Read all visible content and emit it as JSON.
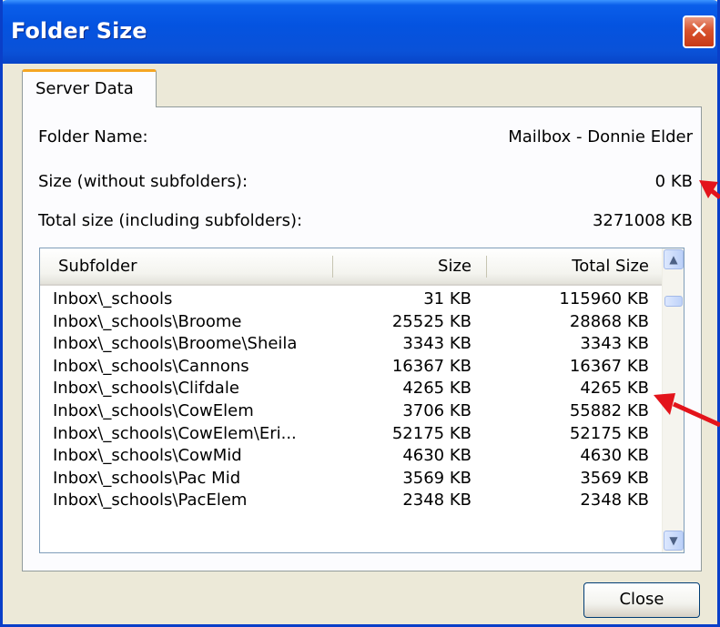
{
  "window": {
    "title": "Folder Size"
  },
  "tab": {
    "label": "Server Data"
  },
  "info": {
    "folder_name_label": "Folder Name:",
    "folder_name_value": "Mailbox - Donnie Elder",
    "size_label": "Size (without subfolders):",
    "size_value": "0 KB",
    "total_label": "Total size (including subfolders):",
    "total_value": "3271008 KB"
  },
  "list": {
    "columns": [
      "Subfolder",
      "Size",
      "Total Size"
    ],
    "rows": [
      [
        "Inbox\\_schools",
        "31 KB",
        "115960 KB"
      ],
      [
        "Inbox\\_schools\\Broome",
        "25525 KB",
        "28868 KB"
      ],
      [
        "Inbox\\_schools\\Broome\\Sheila",
        "3343 KB",
        "3343 KB"
      ],
      [
        "Inbox\\_schools\\Cannons",
        "16367 KB",
        "16367 KB"
      ],
      [
        "Inbox\\_schools\\Clifdale",
        "4265 KB",
        "4265 KB"
      ],
      [
        "Inbox\\_schools\\CowElem",
        "3706 KB",
        "55882 KB"
      ],
      [
        "Inbox\\_schools\\CowElem\\Eri...",
        "52175 KB",
        "52175 KB"
      ],
      [
        "Inbox\\_schools\\CowMid",
        "4630 KB",
        "4630 KB"
      ],
      [
        "Inbox\\_schools\\Pac Mid",
        "3569 KB",
        "3569 KB"
      ],
      [
        "Inbox\\_schools\\PacElem",
        "2348 KB",
        "2348 KB"
      ]
    ]
  },
  "buttons": {
    "close": "Close"
  },
  "colors": {
    "titlebar": "#0453E0",
    "annotation_arrow": "#E3141B",
    "tab_accent": "#F5A623"
  }
}
